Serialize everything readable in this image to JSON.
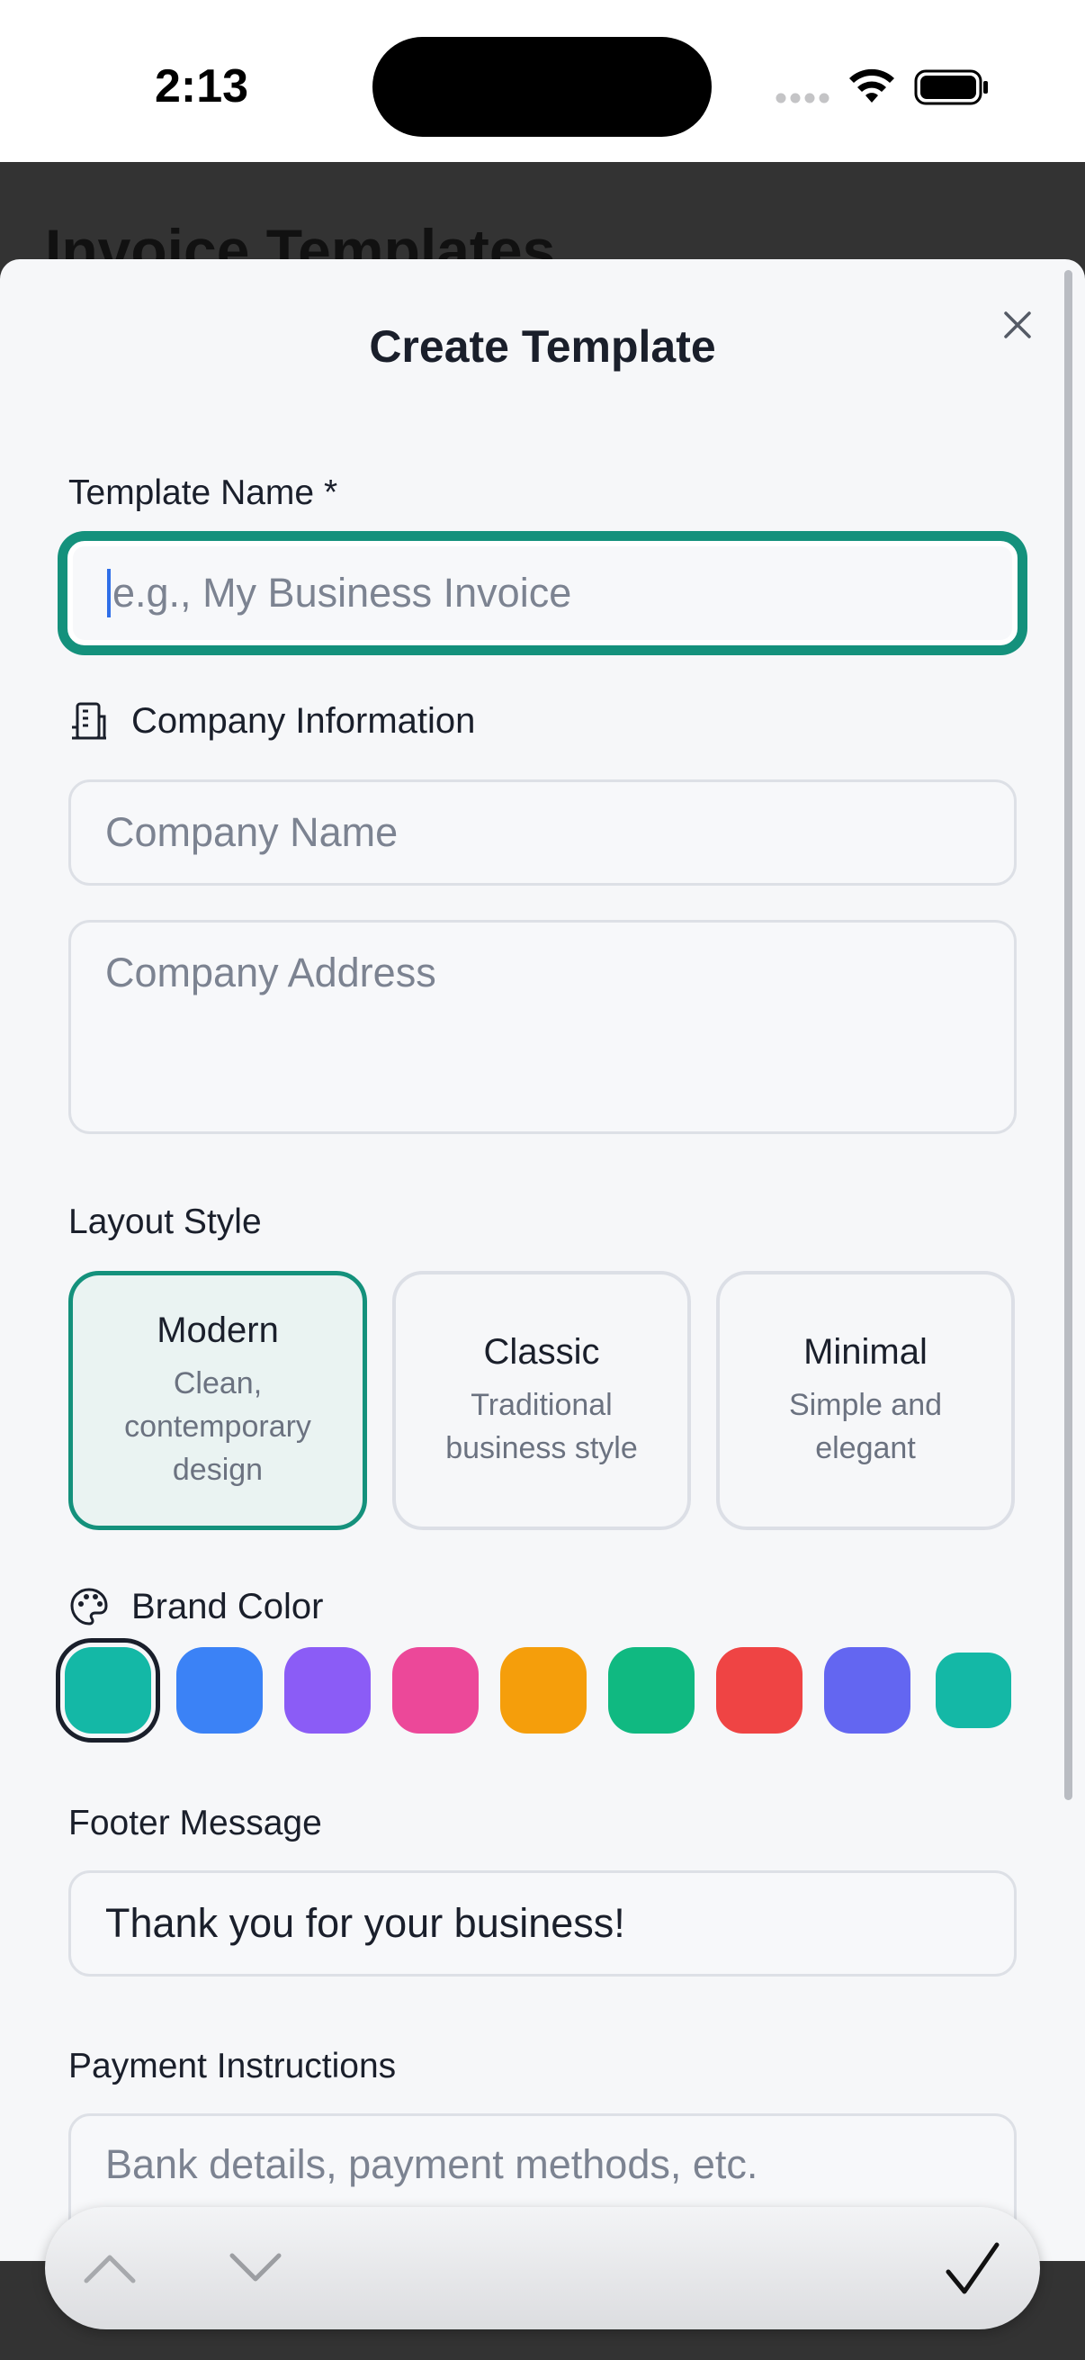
{
  "status_bar": {
    "time": "2:13"
  },
  "background": {
    "title": "Invoice Templates"
  },
  "sheet": {
    "title": "Create Template",
    "template_name": {
      "label": "Template Name *",
      "placeholder": "e.g., My Business Invoice"
    },
    "company_section": {
      "label": "Company Information"
    },
    "company_name": {
      "placeholder": "Company Name"
    },
    "company_address": {
      "placeholder": "Company Address"
    },
    "layout": {
      "label": "Layout Style",
      "options": [
        {
          "name": "Modern",
          "desc": "Clean, contemporary design",
          "selected": true
        },
        {
          "name": "Classic",
          "desc": "Traditional business style",
          "selected": false
        },
        {
          "name": "Minimal",
          "desc": "Simple and elegant",
          "selected": false
        }
      ]
    },
    "brand_color": {
      "label": "Brand Color",
      "colors": [
        "#14b8a6",
        "#3b82f6",
        "#8b5cf6",
        "#ec4899",
        "#f59e0b",
        "#10b981",
        "#ef4444",
        "#6366f1",
        "#14b8a6"
      ],
      "selected_index": 0
    },
    "footer": {
      "label": "Footer Message",
      "value": "Thank you for your business!"
    },
    "payment": {
      "label": "Payment Instructions",
      "placeholder": "Bank details, payment methods, etc."
    }
  },
  "accent_color": "#14917c"
}
